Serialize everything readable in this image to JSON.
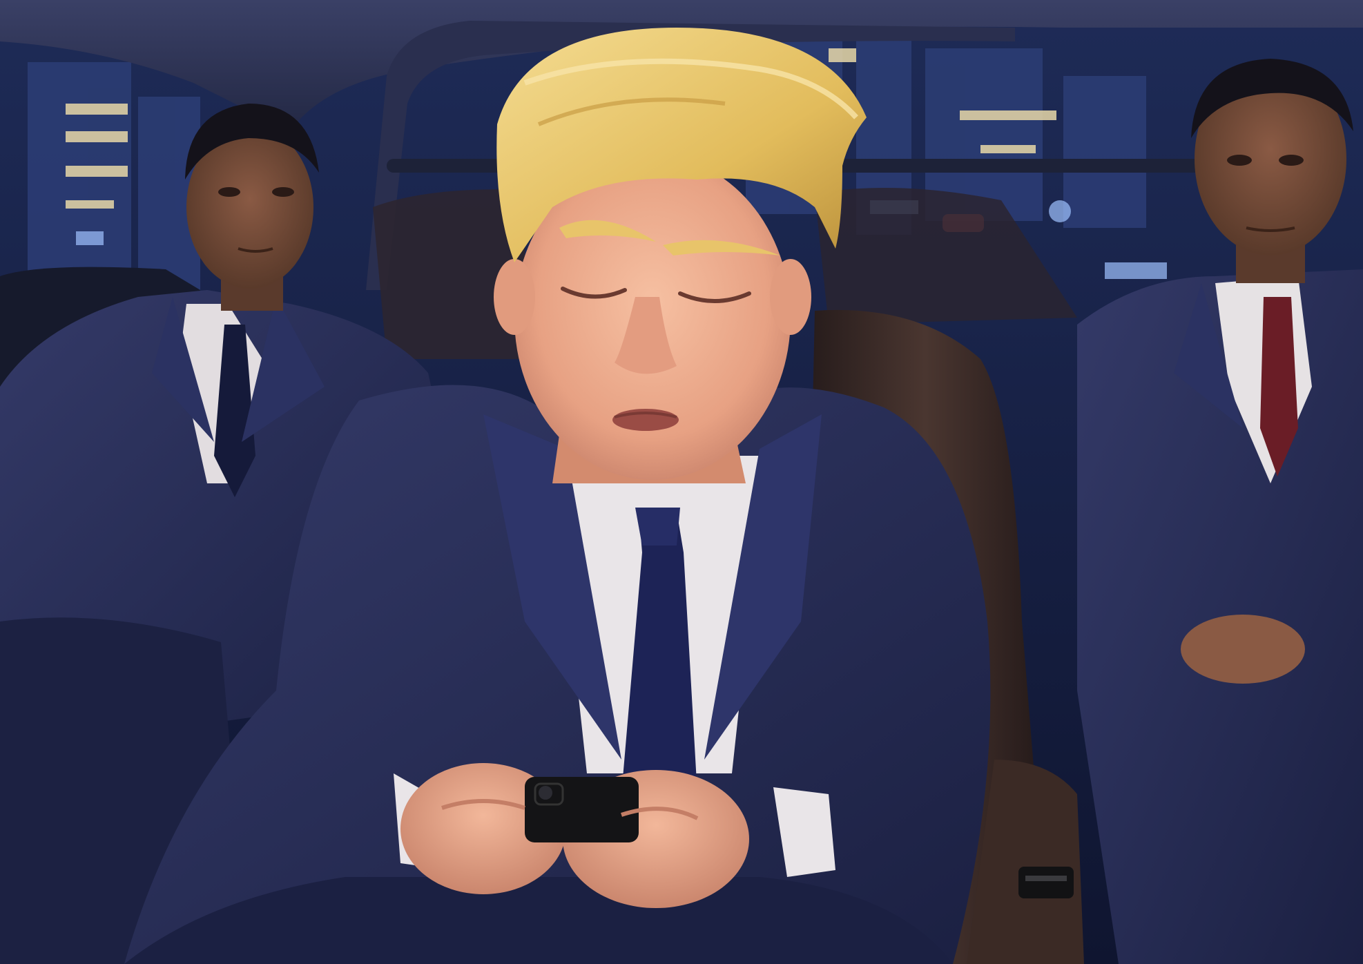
{
  "scene": {
    "kind": "3d-animated-illustration",
    "setting": "car-interior-night",
    "subjects": [
      "center-man-with-phone",
      "left-man-in-suit",
      "right-man-in-suit"
    ],
    "colors": {
      "night_sky": "#1b2a55",
      "cabin_ceiling": "#2a3050",
      "suit_navy": "#262c52",
      "shirt_white": "#e6e2e4",
      "hair_blond": "#e7c46a",
      "skin_peach": "#eba98e",
      "seat_brown": "#3a2a24",
      "phone_black": "#141416"
    }
  }
}
